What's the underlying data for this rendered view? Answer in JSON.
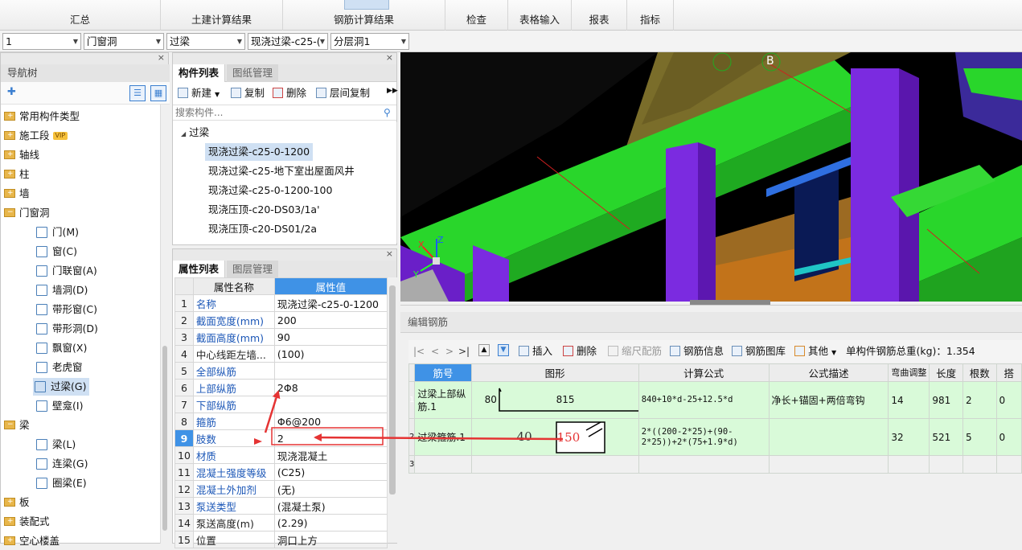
{
  "ribbon": {
    "tabs": [
      "汇总",
      "土建计算结果",
      "钢筋计算结果",
      "检查",
      "表格输入",
      "报表",
      "指标"
    ]
  },
  "selectors": {
    "floor": "1",
    "category": "门窗洞",
    "type": "过梁",
    "component": "现浇过梁-c25-(",
    "layer": "分层洞1"
  },
  "nav": {
    "title": "导航树",
    "close": "×",
    "vip": "VIP",
    "items": [
      {
        "label": "常用构件类型",
        "kind": "folder"
      },
      {
        "label": "施工段",
        "kind": "folder"
      },
      {
        "label": "轴线",
        "kind": "folder"
      },
      {
        "label": "柱",
        "kind": "folder"
      },
      {
        "label": "墙",
        "kind": "folder"
      },
      {
        "label": "门窗洞",
        "kind": "folder-open"
      },
      {
        "label": "门(M)",
        "kind": "child"
      },
      {
        "label": "窗(C)",
        "kind": "child"
      },
      {
        "label": "门联窗(A)",
        "kind": "child"
      },
      {
        "label": "墙洞(D)",
        "kind": "child"
      },
      {
        "label": "带形窗(C)",
        "kind": "child"
      },
      {
        "label": "带形洞(D)",
        "kind": "child"
      },
      {
        "label": "飘窗(X)",
        "kind": "child"
      },
      {
        "label": "老虎窗",
        "kind": "child"
      },
      {
        "label": "过梁(G)",
        "kind": "child-selected"
      },
      {
        "label": "壁龛(I)",
        "kind": "child"
      },
      {
        "label": "梁",
        "kind": "folder-open"
      },
      {
        "label": "梁(L)",
        "kind": "child"
      },
      {
        "label": "连梁(G)",
        "kind": "child"
      },
      {
        "label": "圈梁(E)",
        "kind": "child"
      },
      {
        "label": "板",
        "kind": "folder"
      },
      {
        "label": "装配式",
        "kind": "folder"
      },
      {
        "label": "空心楼盖",
        "kind": "folder"
      }
    ]
  },
  "component_list": {
    "tabs": [
      "构件列表",
      "图纸管理"
    ],
    "toolbar": {
      "new": "新建",
      "copy": "复制",
      "delete": "删除",
      "floor_copy": "层间复制"
    },
    "search_placeholder": "搜索构件...",
    "group": "过梁",
    "items": [
      "现浇过梁-c25-0-1200",
      "现浇过梁-c25-地下室出屋面风井",
      "现浇过梁-c25-0-1200-100",
      "现浇压顶-c20-DS03/1a'",
      "现浇压顶-c20-DS01/2a"
    ]
  },
  "properties": {
    "tabs": [
      "属性列表",
      "图层管理"
    ],
    "col_name": "属性名称",
    "col_value": "属性值",
    "rows": [
      {
        "idx": "1",
        "name": "名称",
        "value": "现浇过梁-c25-0-1200",
        "blue": true
      },
      {
        "idx": "2",
        "name": "截面宽度(mm)",
        "value": "200",
        "blue": true
      },
      {
        "idx": "3",
        "name": "截面高度(mm)",
        "value": "90",
        "blue": true
      },
      {
        "idx": "4",
        "name": "中心线距左墙...",
        "value": "(100)",
        "blue": false
      },
      {
        "idx": "5",
        "name": "全部纵筋",
        "value": "",
        "blue": true
      },
      {
        "idx": "6",
        "name": "上部纵筋",
        "value": "2Φ8",
        "blue": true
      },
      {
        "idx": "7",
        "name": "下部纵筋",
        "value": "",
        "blue": true
      },
      {
        "idx": "8",
        "name": "箍筋",
        "value": "Φ6@200",
        "blue": true
      },
      {
        "idx": "9",
        "name": "肢数",
        "value": "2",
        "blue": true
      },
      {
        "idx": "10",
        "name": "材质",
        "value": "现浇混凝土",
        "blue": true
      },
      {
        "idx": "11",
        "name": "混凝土强度等级",
        "value": "(C25)",
        "blue": true
      },
      {
        "idx": "12",
        "name": "混凝土外加剂",
        "value": "(无)",
        "blue": true
      },
      {
        "idx": "13",
        "name": "泵送类型",
        "value": "(混凝土泵)",
        "blue": true
      },
      {
        "idx": "14",
        "name": "泵送高度(m)",
        "value": "(2.29)",
        "blue": false
      },
      {
        "idx": "15",
        "name": "位置",
        "value": "洞口上方",
        "blue": false
      }
    ]
  },
  "view3d": {
    "axis_label": "B"
  },
  "rebar": {
    "title": "编辑钢筋",
    "toolbar": {
      "nav": [
        "|<",
        "<",
        ">",
        ">|"
      ],
      "insert": "插入",
      "delete": "删除",
      "scale": "缩尺配筋",
      "info": "钢筋信息",
      "library": "钢筋图库",
      "other": "其他",
      "total_weight": "单构件钢筋总重(kg)：1.354"
    },
    "headers": [
      "筋号",
      "图形",
      "计算公式",
      "公式描述",
      "弯曲调整",
      "长度",
      "根数",
      "搭"
    ],
    "rows": [
      {
        "no": "1",
        "name": "过梁上部纵筋.1",
        "shape_a": "80",
        "shape_b": "815",
        "formula": "840+10*d-25+12.5*d",
        "desc": "净长+锚固+两倍弯钩",
        "bend": "14",
        "length": "981",
        "count": "2",
        "lap": "0"
      },
      {
        "no": "2",
        "name": "过梁箍筋.1",
        "shape_a": "40",
        "shape_b": "150",
        "formula": "2*((200-2*25)+(90-2*25))+2*(75+1.9*d)",
        "desc": "",
        "bend": "32",
        "length": "521",
        "count": "5",
        "lap": "0"
      },
      {
        "no": "3",
        "name": "",
        "shape_a": "",
        "shape_b": "",
        "formula": "",
        "desc": "",
        "bend": "",
        "length": "",
        "count": "",
        "lap": ""
      }
    ]
  },
  "colors": {
    "accent_blue": "#1c57b7",
    "header_blue": "#3f92e6",
    "row_green": "#d9fad9",
    "annotation_red": "#e53333"
  }
}
